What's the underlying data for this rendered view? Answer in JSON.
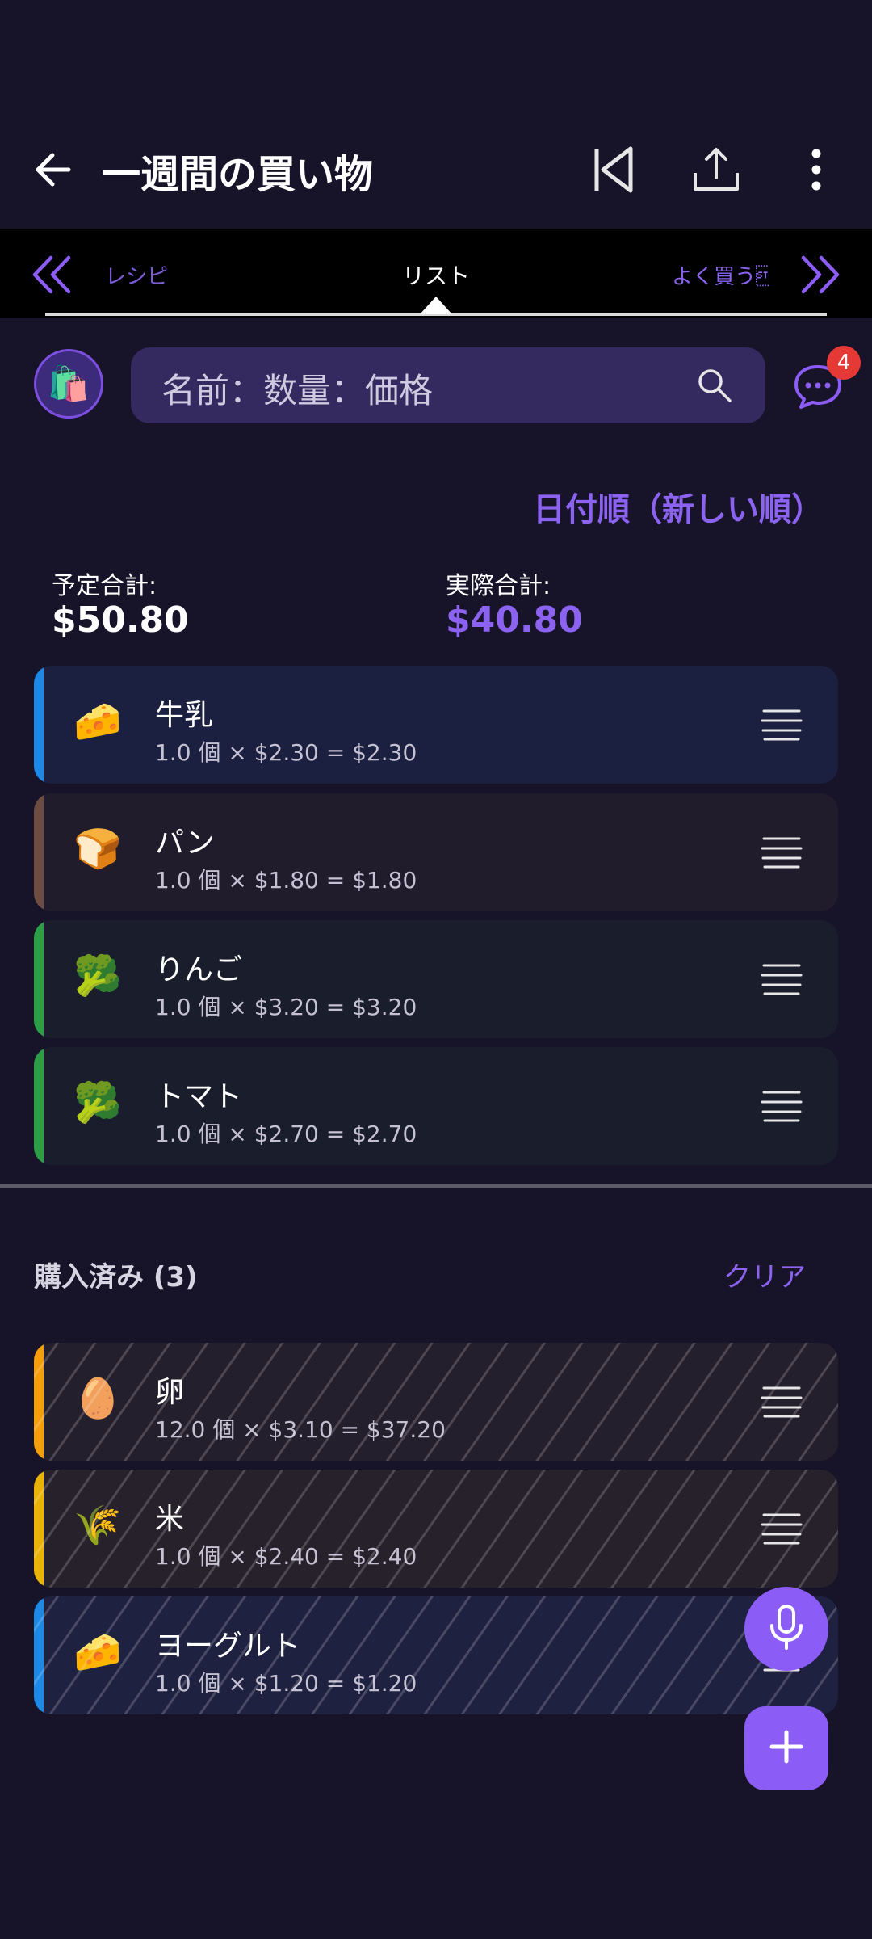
{
  "header": {
    "title": "一週間の買い物",
    "icons": [
      "back-arrow-icon",
      "skip-previous-icon",
      "share-icon",
      "more-vert-icon"
    ]
  },
  "tabs": {
    "left_label": "レシピ",
    "center_label": "リスト",
    "right_label": "よく買う\u0002"
  },
  "search": {
    "placeholder": "名前：数量：価格",
    "chat_badge": "4"
  },
  "sort_label": "日付順（新しい順）",
  "totals": {
    "planned_label": "予定合計:",
    "planned_value": "$50.80",
    "actual_label": "実際合計:",
    "actual_value": "$40.80"
  },
  "items": [
    {
      "emoji": "🧀",
      "name": "牛乳",
      "detail": "1.0 個 × $2.30 = $2.30",
      "color": "#1e88e5"
    },
    {
      "emoji": "🍞",
      "name": "パン",
      "detail": "1.0 個 × $1.80 = $1.80",
      "color": "#6d4c41"
    },
    {
      "emoji": "🥦",
      "name": "りんご",
      "detail": "1.0 個 × $3.20 = $3.20",
      "color": "#2e9e46"
    },
    {
      "emoji": "🥦",
      "name": "トマト",
      "detail": "1.0 個 × $2.70 = $2.70",
      "color": "#2e9e46"
    }
  ],
  "purchased": {
    "header": "購入済み (3)",
    "clear_label": "クリア",
    "items": [
      {
        "emoji": "🥚",
        "name": "卵",
        "detail": "12.0 個 × $3.10 = $37.20",
        "color": "#f59e0b"
      },
      {
        "emoji": "🌾",
        "name": "米",
        "detail": "1.0 個 × $2.40 = $2.40",
        "color": "#eab308"
      },
      {
        "emoji": "🧀",
        "name": "ヨーグルト",
        "detail": "1.0 個 × $1.20 = $1.20",
        "color": "#1e88e5"
      }
    ]
  },
  "colors": {
    "accent": "#8b5cf6",
    "background": "#17142a",
    "badge": "#e53935"
  }
}
